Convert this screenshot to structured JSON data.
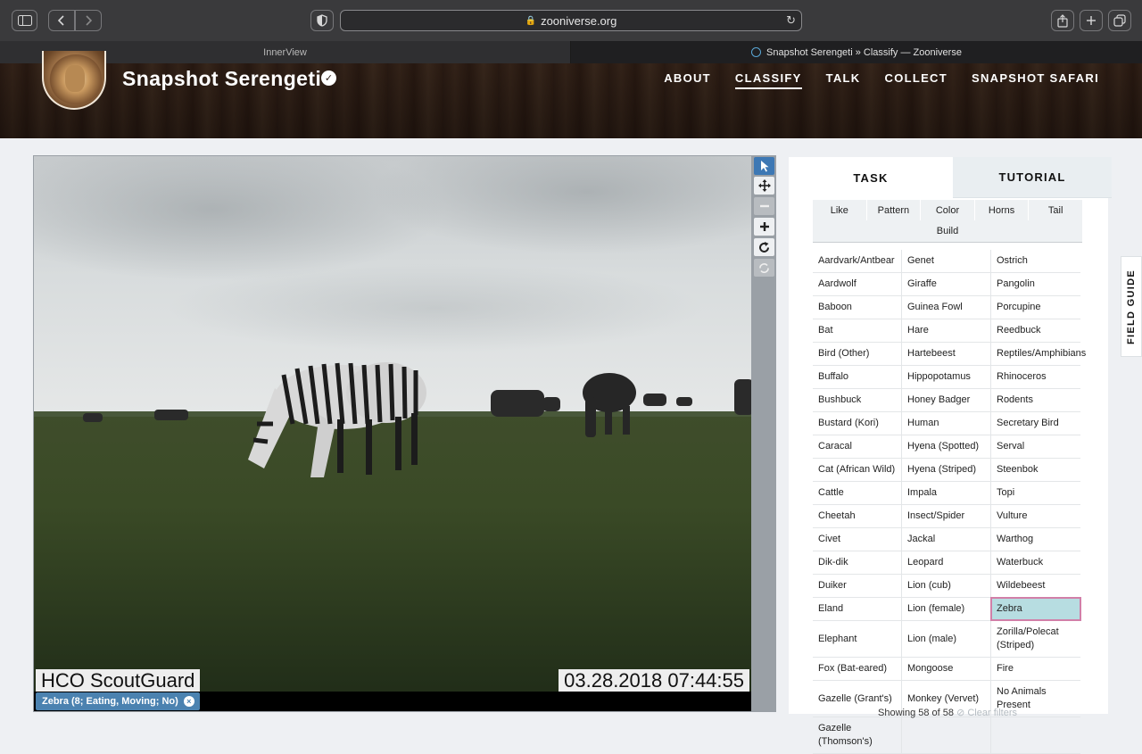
{
  "browser": {
    "url": "zooniverse.org",
    "tabs": [
      {
        "title": "InnerView",
        "active": false
      },
      {
        "title": "Snapshot Serengeti » Classify — Zooniverse",
        "active": true
      }
    ]
  },
  "site": {
    "title": "Snapshot Serengeti",
    "nav": [
      {
        "label": "ABOUT",
        "active": false
      },
      {
        "label": "CLASSIFY",
        "active": true
      },
      {
        "label": "TALK",
        "active": false
      },
      {
        "label": "COLLECT",
        "active": false
      },
      {
        "label": "SNAPSHOT SAFARI",
        "active": false
      }
    ]
  },
  "viewer": {
    "camera_label": "HCO ScoutGuard",
    "timestamp": "03.28.2018 07:44:55",
    "selection_chip": "Zebra (8; Eating, Moving; No)",
    "chip_close": "×"
  },
  "panel": {
    "tabs": {
      "task": "TASK",
      "tutorial": "TUTORIAL"
    },
    "filters_row1": [
      "Like",
      "Pattern",
      "Color",
      "Horns",
      "Tail"
    ],
    "filters_row2": [
      "Build"
    ],
    "species_rows": [
      [
        "Aardvark/Antbear",
        "Genet",
        "Ostrich"
      ],
      [
        "Aardwolf",
        "Giraffe",
        "Pangolin"
      ],
      [
        "Baboon",
        "Guinea Fowl",
        "Porcupine"
      ],
      [
        "Bat",
        "Hare",
        "Reedbuck"
      ],
      [
        "Bird (Other)",
        "Hartebeest",
        "Reptiles/Amphibians"
      ],
      [
        "Buffalo",
        "Hippopotamus",
        "Rhinoceros"
      ],
      [
        "Bushbuck",
        "Honey Badger",
        "Rodents"
      ],
      [
        "Bustard (Kori)",
        "Human",
        "Secretary Bird"
      ],
      [
        "Caracal",
        "Hyena (Spotted)",
        "Serval"
      ],
      [
        "Cat (African Wild)",
        "Hyena (Striped)",
        "Steenbok"
      ],
      [
        "Cattle",
        "Impala",
        "Topi"
      ],
      [
        "Cheetah",
        "Insect/Spider",
        "Vulture"
      ],
      [
        "Civet",
        "Jackal",
        "Warthog"
      ],
      [
        "Dik-dik",
        "Leopard",
        "Waterbuck"
      ],
      [
        "Duiker",
        "Lion (cub)",
        "Wildebeest"
      ],
      [
        "Eland",
        "Lion (female)",
        "Zebra"
      ],
      [
        "Elephant",
        "Lion (male)",
        "Zorilla/Polecat (Striped)"
      ],
      [
        "Fox (Bat-eared)",
        "Mongoose",
        "Fire"
      ],
      [
        "Gazelle (Grant's)",
        "Monkey (Vervet)",
        "No Animals Present"
      ],
      [
        "Gazelle (Thomson's)",
        "",
        ""
      ]
    ],
    "selected_species": "Zebra",
    "showing_text": "Showing 58 of 58",
    "clear_filters": "Clear filters"
  },
  "field_guide": "FIELD GUIDE",
  "colors": {
    "accent": "#3d78b4",
    "selected_cell": "#b7dde1",
    "selected_outline": "#d17fa8",
    "chip": "#4b82b0"
  }
}
